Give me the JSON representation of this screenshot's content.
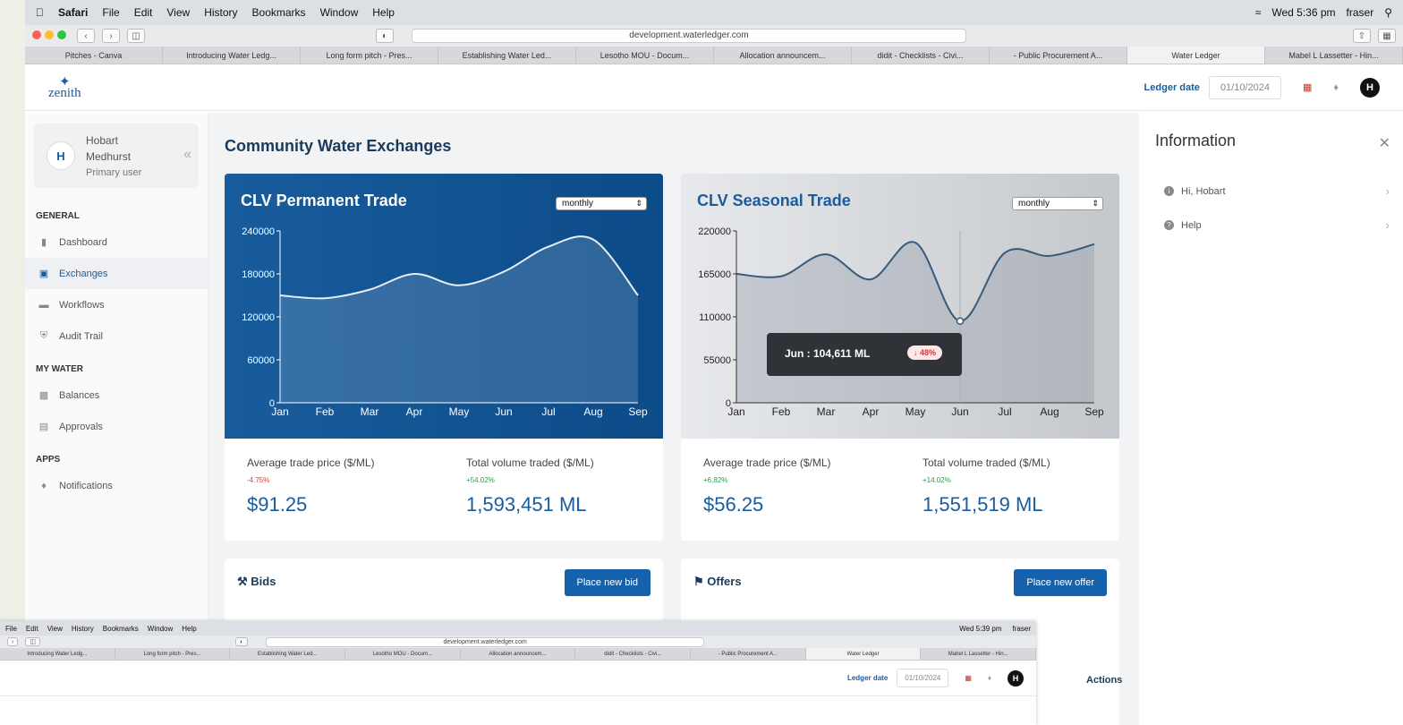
{
  "os": {
    "menubar": {
      "apple": "",
      "app": "Safari",
      "items": [
        "File",
        "Edit",
        "View",
        "History",
        "Bookmarks",
        "Window",
        "Help"
      ],
      "clock": "Wed 5:36 pm",
      "user": "fraser"
    }
  },
  "browser": {
    "url": "development.waterledger.com",
    "tabs": [
      "Pitches - Canva",
      "Introducing Water Ledg...",
      "Long form pitch - Pres...",
      "Establishing Water Led...",
      "Lesotho MOU - Docum...",
      "Allocation announcem...",
      "didit - Checklists - Civi...",
      "- Public Procurement A...",
      "Water Ledger",
      "Mabel L Lassetter - Hin..."
    ]
  },
  "header": {
    "logo": "zenith",
    "ledger_label": "Ledger date",
    "ledger_date": "01/10/2024",
    "avatar": "H"
  },
  "sidebar": {
    "user": {
      "initial": "H",
      "first": "Hobart",
      "last": "Medhurst",
      "role": "Primary user"
    },
    "sections": [
      {
        "title": "GENERAL",
        "items": [
          "Dashboard",
          "Exchanges",
          "Workflows",
          "Audit Trail"
        ]
      },
      {
        "title": "MY WATER",
        "items": [
          "Balances",
          "Approvals"
        ]
      },
      {
        "title": "APPS",
        "items": [
          "Notifications"
        ]
      }
    ]
  },
  "main": {
    "title": "Community Water Exchanges",
    "permanent": {
      "title": "CLV Permanent Trade",
      "period": "monthly",
      "avg_label": "Average trade price ($/ML)",
      "avg_change": "-4.75%",
      "avg_value": "$91.25",
      "vol_label": "Total volume traded ($/ML)",
      "vol_change": "+54.02%",
      "vol_value": "1,593,451 ML"
    },
    "seasonal": {
      "title": "CLV Seasonal Trade",
      "period": "monthly",
      "avg_label": "Average trade price ($/ML)",
      "avg_change": "+6.82%",
      "avg_value": "$56.25",
      "vol_label": "Total volume traded ($/ML)",
      "vol_change": "+14.02%",
      "vol_value": "1,551,519 ML",
      "tooltip": "Jun : 104,611 ML",
      "tooltip_pct": "48%"
    },
    "bids": {
      "title": "Bids",
      "button": "Place new bid"
    },
    "offers": {
      "title": "Offers",
      "button": "Place new offer"
    },
    "actions_label": "Actions"
  },
  "info": {
    "title": "Information",
    "items": [
      "Hi, Hobart",
      "Help"
    ]
  },
  "overlay": {
    "clock": "Wed 5:39 pm",
    "user": "fraser"
  },
  "chart_data": [
    {
      "type": "area",
      "title": "CLV Permanent Trade",
      "categories": [
        "Jan",
        "Feb",
        "Mar",
        "Apr",
        "May",
        "Jun",
        "Jul",
        "Aug",
        "Sep"
      ],
      "values": [
        150000,
        146000,
        158000,
        180000,
        164000,
        183000,
        218000,
        228000,
        150000
      ],
      "ylim": [
        0,
        240000
      ],
      "yticks": [
        0,
        60000,
        120000,
        180000,
        240000
      ]
    },
    {
      "type": "area",
      "title": "CLV Seasonal Trade",
      "categories": [
        "Jan",
        "Feb",
        "Mar",
        "Apr",
        "May",
        "Jun",
        "Jul",
        "Aug",
        "Sep"
      ],
      "values": [
        165000,
        162000,
        190000,
        158000,
        205000,
        104611,
        192000,
        188000,
        203000
      ],
      "ylim": [
        0,
        220000
      ],
      "yticks": [
        0,
        55000,
        110000,
        165000,
        220000
      ],
      "highlight_index": 5
    }
  ],
  "colors": {
    "primary": "#1a5c9e",
    "negative": "#e53935",
    "positive": "#2e9c4f"
  }
}
